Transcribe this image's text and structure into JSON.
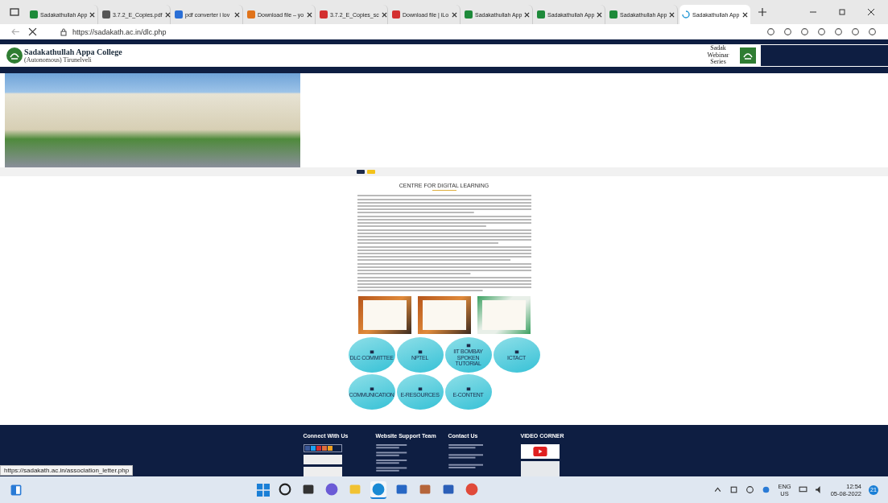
{
  "browser": {
    "tabs": [
      {
        "title": "Sadakathullah App",
        "kind": "site",
        "selected": false
      },
      {
        "title": "3.7.2_E_Copies.pdf",
        "kind": "doc",
        "selected": false
      },
      {
        "title": "pdf converter i lov",
        "kind": "search",
        "selected": false
      },
      {
        "title": "Download file – yo",
        "kind": "ilovepdf",
        "selected": false
      },
      {
        "title": "3.7.2_E_Copies_sc",
        "kind": "pdf",
        "selected": false
      },
      {
        "title": "Download file | iLo",
        "kind": "heart",
        "selected": false
      },
      {
        "title": "Sadakathullah App",
        "kind": "site",
        "selected": false
      },
      {
        "title": "Sadakathullah App",
        "kind": "site",
        "selected": false
      },
      {
        "title": "Sadakathullah App",
        "kind": "site",
        "selected": false
      },
      {
        "title": "Sadakathullah App",
        "kind": "loading",
        "selected": true
      }
    ],
    "url": "https://sadakath.ac.in/dlc.php"
  },
  "header": {
    "college_name": "Sadakathullah Appa College",
    "subtitle": "(Autonomous) Tirunelveli",
    "webinar": "Sadak Webinar Series"
  },
  "content": {
    "title": "CENTRE FOR DIGITAL LEARNING",
    "certificates": [
      {
        "kind": "orange"
      },
      {
        "kind": "orange"
      },
      {
        "kind": "green"
      }
    ],
    "circles": [
      {
        "label": "DLC COMMITTEE"
      },
      {
        "label": "NPTEL"
      },
      {
        "label": "IIT BOMBAY SPOKEN TUTORIAL"
      },
      {
        "label": "ICTACT"
      },
      {
        "label": "COMMUNICATION"
      },
      {
        "label": "E-RESOURCES"
      },
      {
        "label": "E-CONTENT"
      }
    ]
  },
  "footer": {
    "headings": [
      "Connect With Us",
      "Website Support Team",
      "Contact Us",
      "VIDEO CORNER"
    ]
  },
  "status_url": "https://sadakath.ac.in/association_letter.php",
  "taskbar": {
    "apps": [
      {
        "kind": "search",
        "selected": false
      },
      {
        "kind": "taskview",
        "selected": false
      },
      {
        "kind": "chat",
        "selected": false
      },
      {
        "kind": "explorer",
        "selected": false
      },
      {
        "kind": "edge",
        "selected": true
      },
      {
        "kind": "store",
        "selected": false
      },
      {
        "kind": "app",
        "selected": false
      },
      {
        "kind": "word",
        "selected": false
      },
      {
        "kind": "chrome",
        "selected": false
      }
    ],
    "lang": "ENG",
    "region": "US",
    "time": "12:54",
    "date": "05-08-2022",
    "badge": "21"
  }
}
